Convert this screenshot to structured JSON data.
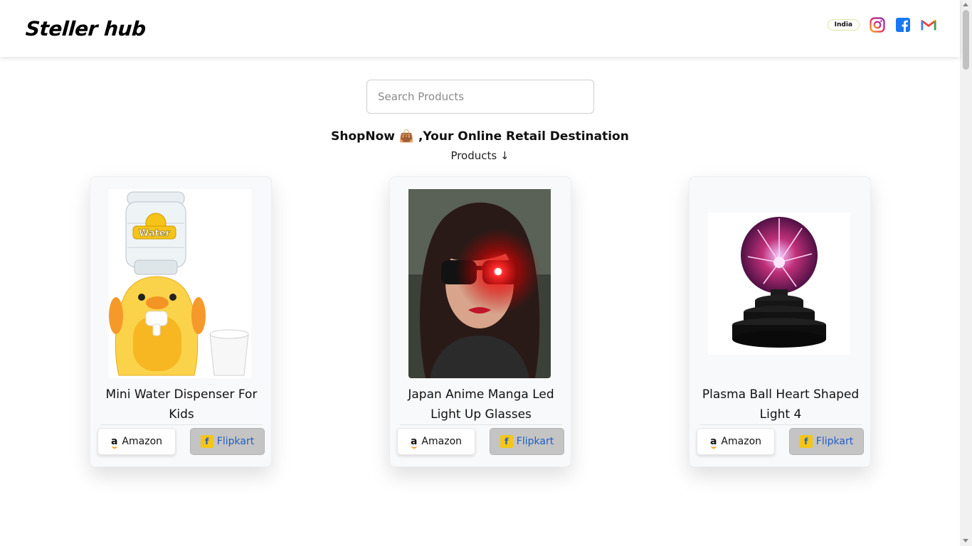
{
  "header": {
    "logo": "Steller hub",
    "country": "India",
    "icons": [
      "instagram-icon",
      "facebook-icon",
      "gmail-icon"
    ]
  },
  "search": {
    "placeholder": "Search Products"
  },
  "tagline": "ShopNow 👜 ,Your Online Retail Destination",
  "products_heading": "Products ↓",
  "products": [
    {
      "title": "Mini Water Dispenser For Kids",
      "amazon_label": "Amazon",
      "flipkart_label": "Flipkart",
      "image_label": "Water"
    },
    {
      "title": "Japan Anime Manga Led Light Up Glasses",
      "amazon_label": "Amazon",
      "flipkart_label": "Flipkart"
    },
    {
      "title": "Plasma Ball Heart Shaped Light 4",
      "amazon_label": "Amazon",
      "flipkart_label": "Flipkart"
    }
  ],
  "colors": {
    "card_bg": "#f8f9fb",
    "flipkart_text": "#1e5fc7",
    "flipkart_btn_bg": "#c4c4c4",
    "badge_border": "#d9e89a"
  }
}
